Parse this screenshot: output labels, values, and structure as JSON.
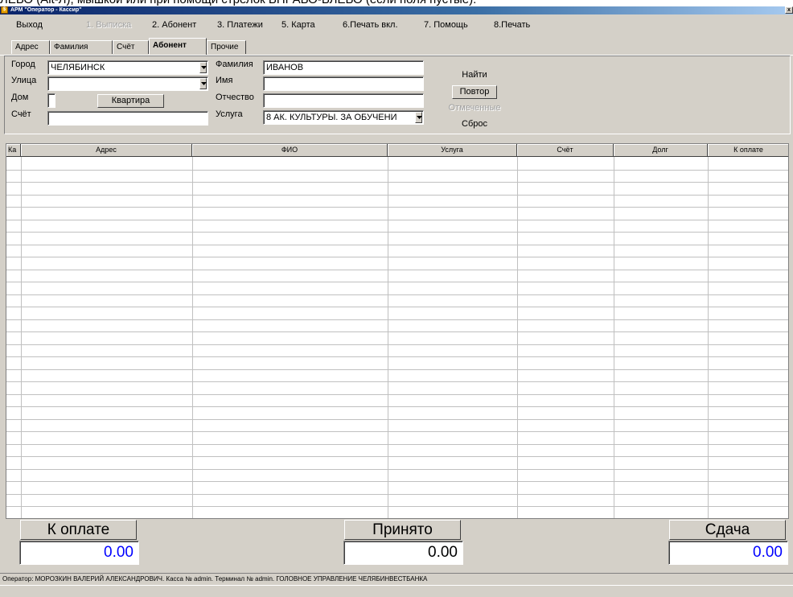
{
  "top_text": "ЛЕВО (Alt-Л), мышкой или при помощи стрелок ВПРАВО-ВЛЕВО (если поля пустые).",
  "window": {
    "title": "АРМ \"Оператор - Кассир\"",
    "close": "x"
  },
  "menu": [
    {
      "label": "Выход",
      "disabled": false
    },
    {
      "label": "1. Выписка",
      "disabled": true
    },
    {
      "label": "2. Абонент",
      "disabled": false
    },
    {
      "label": "3. Платежи",
      "disabled": false
    },
    {
      "label": "5. Карта",
      "disabled": false
    },
    {
      "label": "6.Печать вкл.",
      "disabled": false
    },
    {
      "label": "7. Помощь",
      "disabled": false
    },
    {
      "label": "8.Печать",
      "disabled": false
    }
  ],
  "tabs": [
    {
      "label": "Адрес",
      "active": false
    },
    {
      "label": "Фамилия",
      "active": false
    },
    {
      "label": "Счёт",
      "active": false
    },
    {
      "label": "Абонент",
      "active": true
    },
    {
      "label": "Прочие",
      "active": false
    }
  ],
  "form": {
    "city_label": "Город",
    "city_value": "ЧЕЛЯБИНСК",
    "street_label": "Улица",
    "street_value": "",
    "house_label": "Дом",
    "house_value": "",
    "apartment_button": "Квартира",
    "account_label": "Счёт",
    "account_value": "",
    "surname_label": "Фамилия",
    "surname_value": "ИВАНОВ",
    "name_label": "Имя",
    "name_value": "",
    "patronymic_label": "Отчество",
    "patronymic_value": "",
    "service_label": "Услуга",
    "service_value": "8 АК. КУЛЬТУРЫ. ЗА ОБУЧЕНИ"
  },
  "actions": {
    "find": "Найти",
    "repeat": "Повтор",
    "marked": "Отмеченные",
    "reset": "Сброс"
  },
  "grid": {
    "columns": [
      "Ка",
      "Адрес",
      "ФИО",
      "Услуга",
      "Счёт",
      "Долг",
      "К оплате"
    ],
    "rows": []
  },
  "totals": {
    "to_pay_label": "К оплате",
    "to_pay_value": "0.00",
    "received_label": "Принято",
    "received_value": "0.00",
    "change_label": "Сдача",
    "change_value": "0.00"
  },
  "status": "Оператор: МОРОЗКИН ВАЛЕРИЙ АЛЕКСАНДРОВИЧ. Касса № admin. Терминал № admin. ГОЛОВНОЕ УПРАВЛЕНИЕ ЧЕЛЯБИНВЕСТБАНКА",
  "colors": {
    "title_start": "#0a246a",
    "title_end": "#a6caf0",
    "value_text": "#0000ff",
    "face": "#d4d0c8"
  }
}
